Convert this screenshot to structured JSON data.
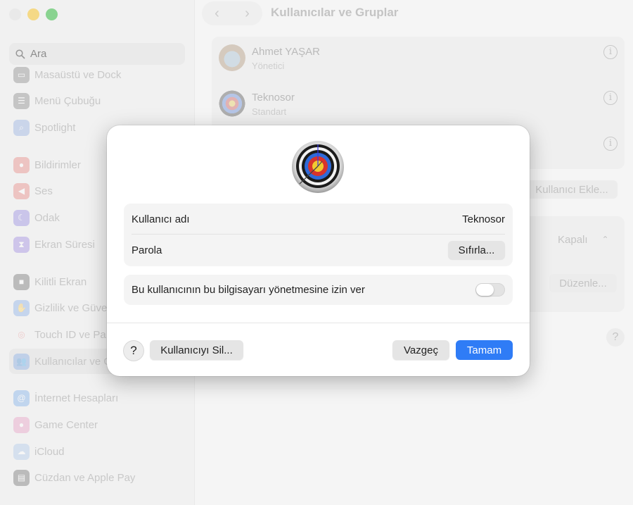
{
  "window": {
    "title": "Kullanıcılar ve Gruplar"
  },
  "search": {
    "placeholder": "Ara"
  },
  "sidebar": {
    "items": [
      {
        "label": "Masaüstü ve Dock",
        "color": "#5a5a5a"
      },
      {
        "label": "Menü Çubuğu",
        "color": "#5a5a5a"
      },
      {
        "label": "Spotlight",
        "color": "#6b8fd6"
      },
      {
        "label": "Bildirimler",
        "color": "#e2584f"
      },
      {
        "label": "Ses",
        "color": "#e2584f"
      },
      {
        "label": "Odak",
        "color": "#6a5bd6"
      },
      {
        "label": "Ekran Süresi",
        "color": "#7a5bd6"
      },
      {
        "label": "Kilitli Ekran",
        "color": "#3a3a3a"
      },
      {
        "label": "Gizlilik ve Güve",
        "color": "#5a8fe0"
      },
      {
        "label": "Touch ID ve Pa",
        "color": "#f0f0f0"
      },
      {
        "label": "Kullanıcılar ve G",
        "color": "#5a8fe0"
      },
      {
        "label": "İnternet Hesapları",
        "color": "#4a8fe6"
      },
      {
        "label": "Game Center",
        "color": "#e07ab0"
      },
      {
        "label": "iCloud",
        "color": "#8fb6e6"
      },
      {
        "label": "Cüzdan ve Apple Pay",
        "color": "#3a3a3a"
      }
    ]
  },
  "users": [
    {
      "name": "Ahmet YAŞAR",
      "role": "Yönetici"
    },
    {
      "name": "Teknosor",
      "role": "Standart"
    }
  ],
  "background": {
    "add_user": "Kullanıcı Ekle...",
    "guest_value": "Kapalı",
    "edit": "Düzenle...",
    "help": "?"
  },
  "dialog": {
    "username_label": "Kullanıcı adı",
    "username_value": "Teknosor",
    "password_label": "Parola",
    "reset_button": "Sıfırla...",
    "admin_label": "Bu kullanıcının bu bilgisayarı yönetmesine izin ver",
    "admin_enabled": false,
    "help": "?",
    "delete_button": "Kullanıcıyı Sil...",
    "cancel_button": "Vazgeç",
    "ok_button": "Tamam",
    "accent": "#2f7cf6"
  }
}
